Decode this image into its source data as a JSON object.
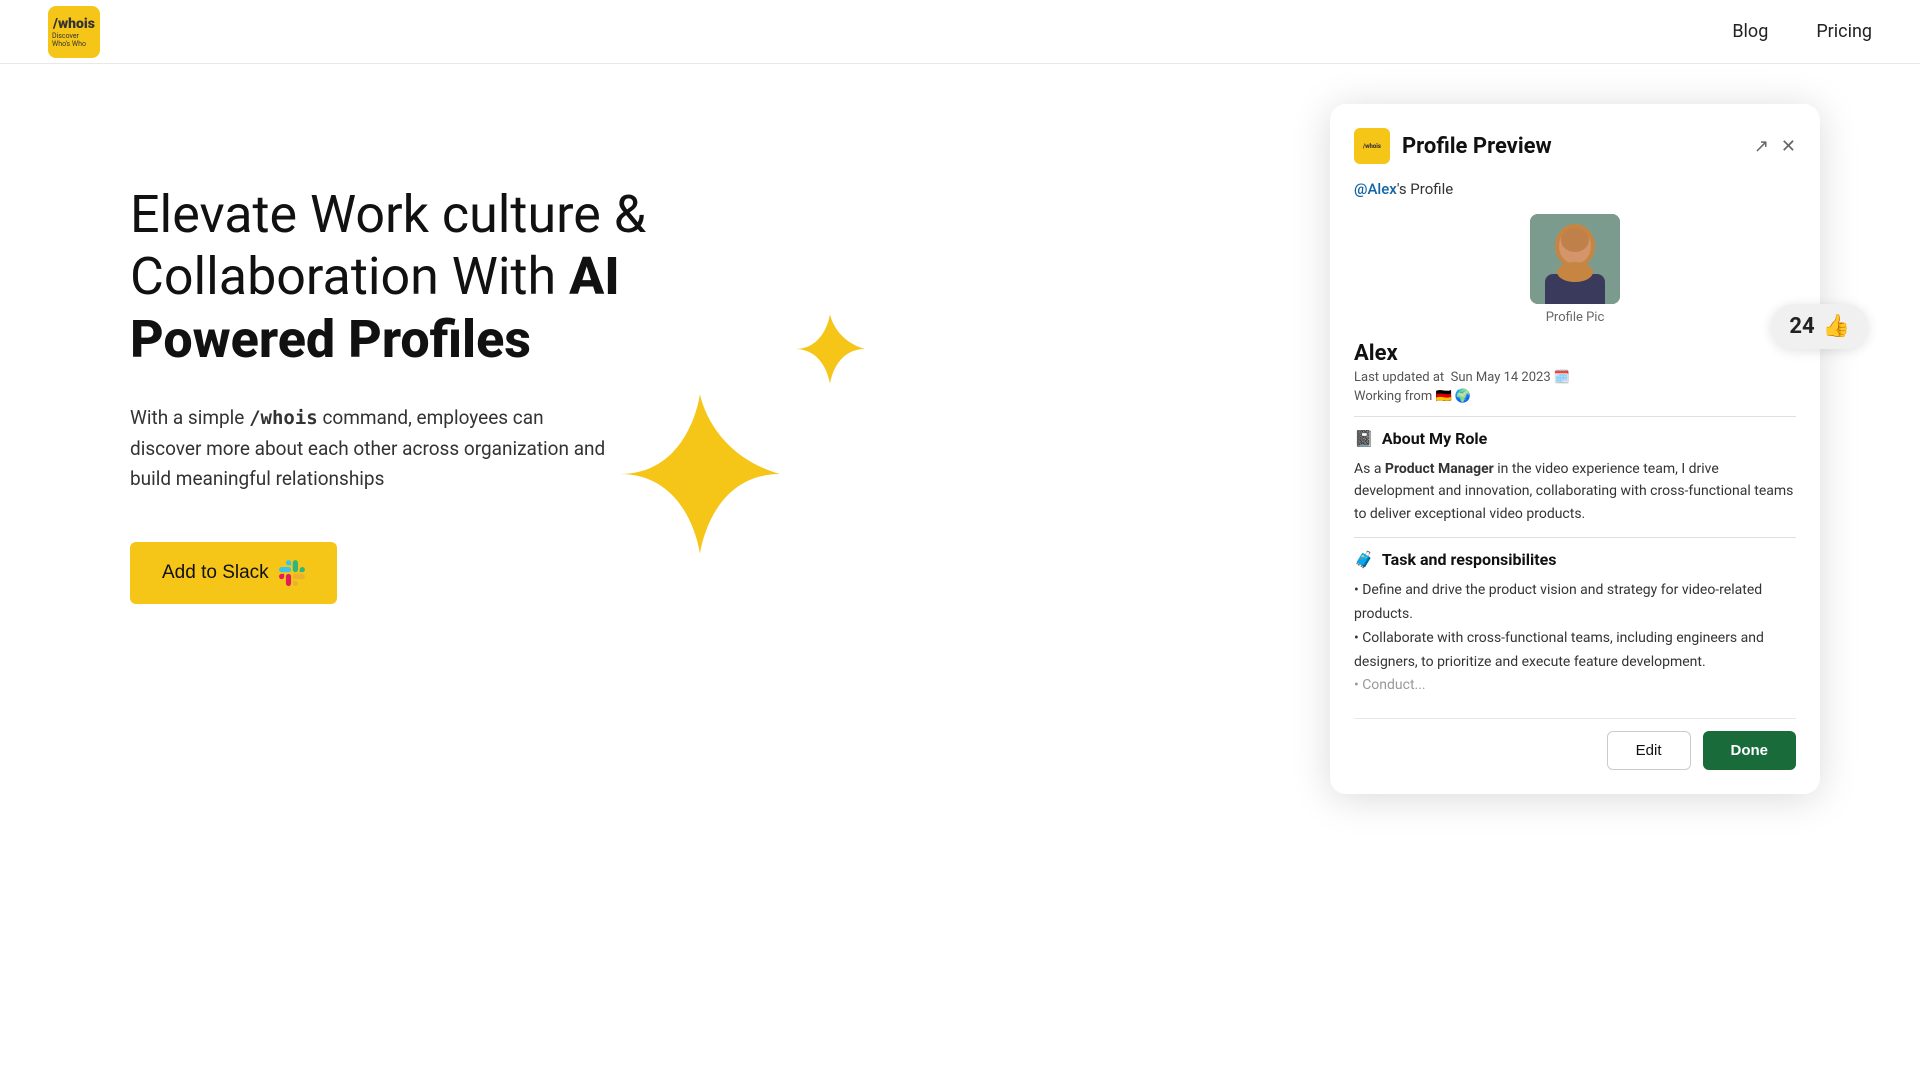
{
  "header": {
    "logo_text": "/whois",
    "nav": {
      "blog": "Blog",
      "pricing": "Pricing"
    }
  },
  "hero": {
    "title_line1": "Elevate Work culture &",
    "title_line2": "Collaboration With ",
    "title_bold": "AI",
    "title_line3": "Powered Profiles",
    "description_prefix": "With a simple ",
    "description_cmd": "/whois",
    "description_suffix": " command, employees can discover more about each other across organization and build meaningful relationships",
    "cta_button": "Add to Slack"
  },
  "profile_card": {
    "title": "Profile Preview",
    "mention": "@Alex",
    "mention_suffix": "'s Profile",
    "profile_pic_label": "Profile Pic",
    "user_name": "Alex",
    "last_updated_label": "Last updated at",
    "last_updated_date": "Sun May 14 2023",
    "working_from_label": "Working from",
    "about_role_header": "About My Role",
    "about_role_content_prefix": "As a ",
    "about_role_bold": "Product Manager",
    "about_role_content_suffix": " in the video experience team, I drive development and innovation, collaborating with cross-functional teams to deliver exceptional video products.",
    "tasks_header": "Task and responsibilites",
    "task1": "• Define and drive the product vision and strategy for video-related products.",
    "task2": "• Collaborate with cross-functional teams, including engineers and designers, to prioritize and execute feature development.",
    "task3": "• Conduct...",
    "edit_button": "Edit",
    "done_button": "Done"
  },
  "thumbs_badge": {
    "count": "24",
    "emoji": "👍"
  }
}
